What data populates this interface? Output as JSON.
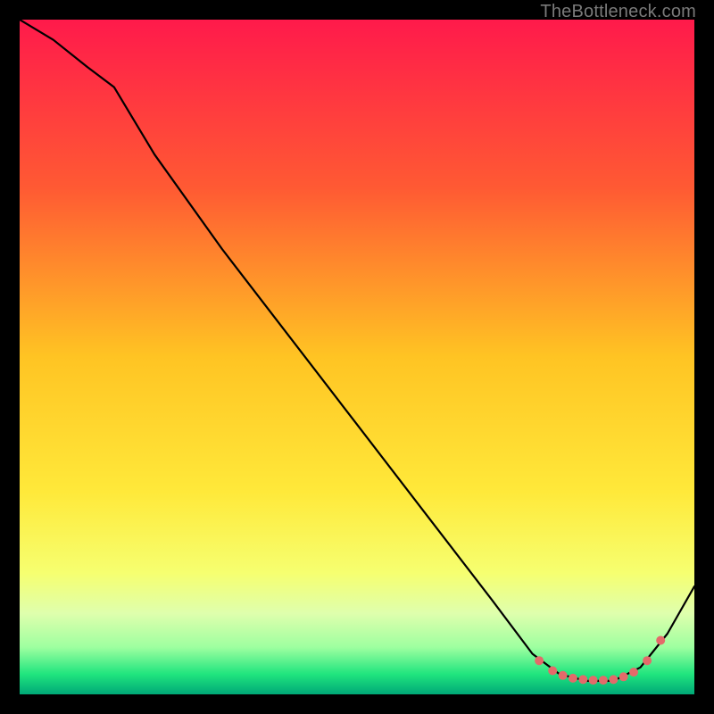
{
  "watermark": "TheBottleneck.com",
  "chart_data": {
    "type": "line",
    "title": "",
    "xlabel": "",
    "ylabel": "",
    "xlim": [
      0,
      100
    ],
    "ylim": [
      0,
      100
    ],
    "grid": false,
    "legend": false,
    "gradient_stops": [
      {
        "offset": 0.0,
        "color": "#ff1a4b"
      },
      {
        "offset": 0.25,
        "color": "#ff5a33"
      },
      {
        "offset": 0.5,
        "color": "#ffc423"
      },
      {
        "offset": 0.7,
        "color": "#ffe93a"
      },
      {
        "offset": 0.82,
        "color": "#f6ff70"
      },
      {
        "offset": 0.88,
        "color": "#dfffad"
      },
      {
        "offset": 0.93,
        "color": "#9effa0"
      },
      {
        "offset": 0.97,
        "color": "#20e57e"
      },
      {
        "offset": 1.0,
        "color": "#00a877"
      }
    ],
    "series": [
      {
        "name": "curve",
        "x": [
          0,
          5,
          10,
          14,
          20,
          30,
          40,
          50,
          60,
          70,
          76,
          80,
          84,
          88,
          92,
          96,
          100
        ],
        "y": [
          100,
          97,
          93,
          90,
          80,
          66,
          53,
          40,
          27,
          14,
          6,
          3,
          2,
          2,
          4,
          9,
          16
        ]
      },
      {
        "name": "markers",
        "x": [
          77,
          79,
          80.5,
          82,
          83.5,
          85,
          86.5,
          88,
          89.5,
          91,
          93,
          95
        ],
        "y": [
          5.0,
          3.5,
          2.8,
          2.4,
          2.2,
          2.1,
          2.1,
          2.2,
          2.6,
          3.3,
          5.0,
          8.0
        ]
      }
    ]
  }
}
